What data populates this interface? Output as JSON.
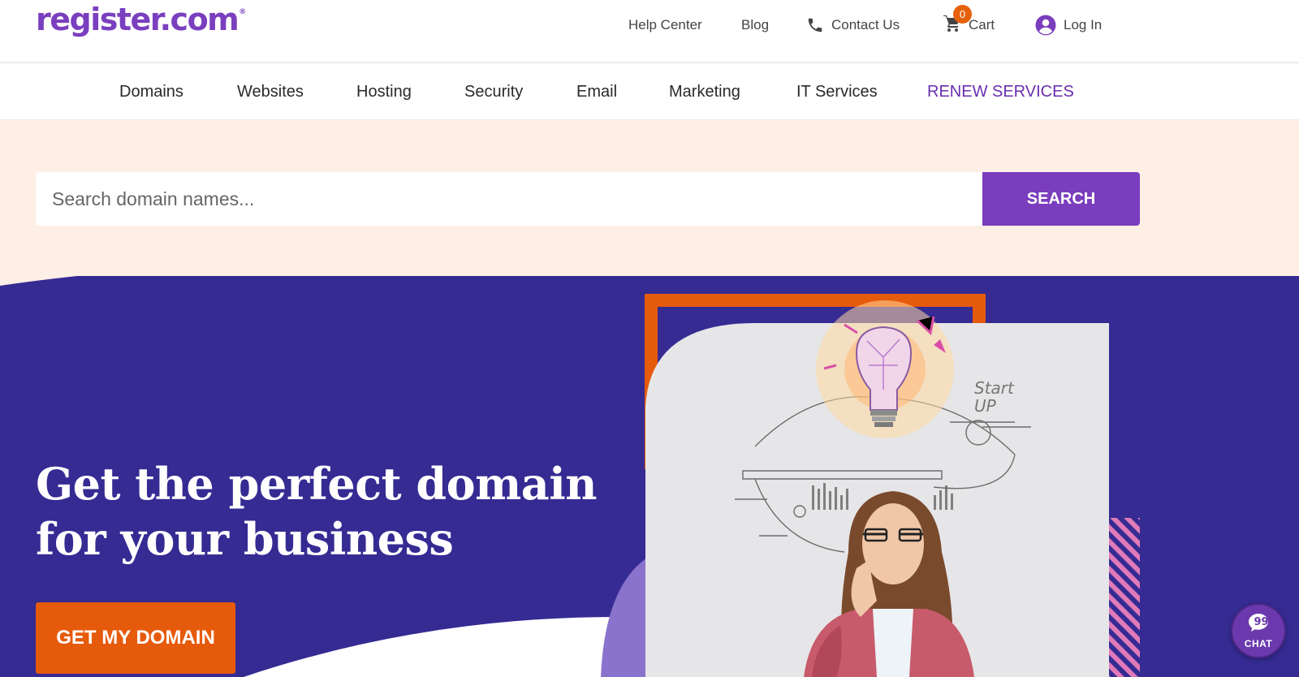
{
  "brand": {
    "logo_text": "register.com",
    "logo_mark": "®"
  },
  "utility_nav": {
    "help_center": "Help Center",
    "blog": "Blog",
    "contact_us": "Contact Us",
    "cart": "Cart",
    "cart_count": "0",
    "login": "Log In"
  },
  "main_nav": {
    "items": [
      "Domains",
      "Websites",
      "Hosting",
      "Security",
      "Email",
      "Marketing",
      "IT Services",
      "RENEW SERVICES"
    ]
  },
  "search": {
    "placeholder": "Search domain names...",
    "value": "",
    "button_label": "SEARCH"
  },
  "hero": {
    "title_line1": "Get the perfect domain",
    "title_line2": "for your business",
    "cta_label": "GET MY DOMAIN",
    "illustration_text": "Start UP"
  },
  "chat": {
    "label": "CHAT"
  },
  "colors": {
    "brand_purple": "#7a3dbd",
    "hero_bg": "#352b93",
    "accent_orange": "#e65a0b",
    "search_band_bg": "#fdeee6",
    "stripe_pink": "#e07ab8"
  },
  "icons": [
    "phone-icon",
    "cart-icon",
    "user-icon",
    "chat-bubble-icon",
    "lightbulb-illustration"
  ]
}
